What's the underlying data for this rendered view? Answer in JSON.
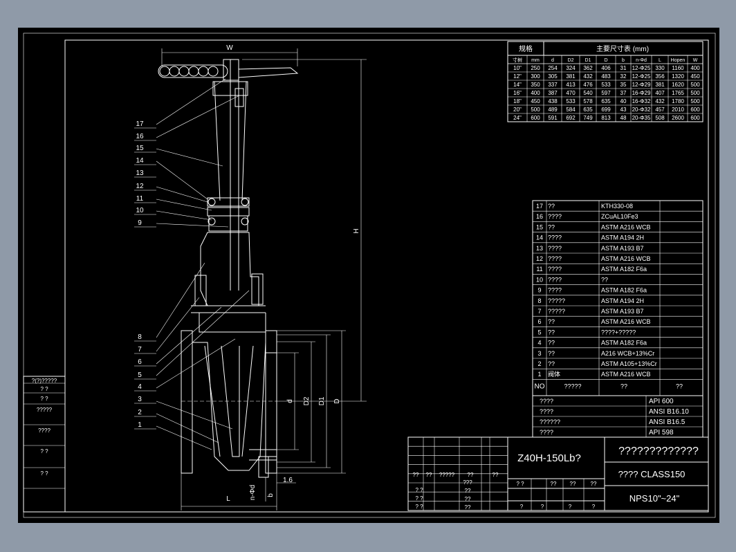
{
  "dimensions": {
    "W": "W",
    "H": "H",
    "L": "L",
    "d": "d",
    "D1": "D1",
    "D2": "D2",
    "D": "D",
    "n_phi_d": "n-Φd",
    "b": "b",
    "t": "1.6"
  },
  "callouts": [
    "17",
    "16",
    "15",
    "14",
    "13",
    "12",
    "11",
    "10",
    "9",
    "8",
    "7",
    "6",
    "5",
    "4",
    "3",
    "2",
    "1"
  ],
  "size_table": {
    "title": "主要尺寸表 (mm)",
    "corner": "规格",
    "headers": [
      "寸树",
      "mm",
      "d",
      "D2",
      "D1",
      "D",
      "b",
      "n-Φd",
      "L",
      "Hopen",
      "W"
    ],
    "rows": [
      [
        "10\"",
        "250",
        "254",
        "324",
        "362",
        "406",
        "31",
        "12-Φ25",
        "330",
        "1160",
        "400"
      ],
      [
        "12\"",
        "300",
        "305",
        "381",
        "432",
        "483",
        "32",
        "12-Φ25",
        "356",
        "1320",
        "450"
      ],
      [
        "14\"",
        "350",
        "337",
        "413",
        "476",
        "533",
        "35",
        "12-Φ29",
        "381",
        "1620",
        "500"
      ],
      [
        "16\"",
        "400",
        "387",
        "470",
        "540",
        "597",
        "37",
        "16-Φ29",
        "407",
        "1765",
        "500"
      ],
      [
        "18\"",
        "450",
        "438",
        "533",
        "578",
        "635",
        "40",
        "16-Φ32",
        "432",
        "1780",
        "500"
      ],
      [
        "20\"",
        "500",
        "489",
        "584",
        "635",
        "699",
        "43",
        "20-Φ32",
        "457",
        "2010",
        "600"
      ],
      [
        "24\"",
        "600",
        "591",
        "692",
        "749",
        "813",
        "48",
        "20-Φ35",
        "508",
        "2600",
        "600"
      ]
    ]
  },
  "parts_list": {
    "rows": [
      [
        "17",
        "??",
        "KTH330-08"
      ],
      [
        "16",
        "????",
        "ZCuAL10Fe3"
      ],
      [
        "15",
        "??",
        "ASTM  A216  WCB"
      ],
      [
        "14",
        "????",
        "ASTM  A194  2H"
      ],
      [
        "13",
        "????",
        "ASTM  A193  B7"
      ],
      [
        "12",
        "????",
        "ASTM  A216  WCB"
      ],
      [
        "11",
        "????",
        "ASTM  A182  F6a"
      ],
      [
        "10",
        "????",
        "??"
      ],
      [
        "9",
        "????",
        "ASTM  A182  F6a"
      ],
      [
        "8",
        "?????",
        "ASTM  A194  2H"
      ],
      [
        "7",
        "?????",
        "ASTM  A193  B7"
      ],
      [
        "6",
        "??",
        "ASTM  A216  WCB"
      ],
      [
        "5",
        "??",
        "????+?????"
      ],
      [
        "4",
        "??",
        "ASTM  A182  F6a"
      ],
      [
        "3",
        "??",
        "A216  WCB+13%Cr"
      ],
      [
        "2",
        "??",
        "ASTM  A105+13%Cr"
      ],
      [
        "1",
        "阀体",
        "ASTM  A216  WCB"
      ]
    ],
    "header": [
      "NO",
      "?????",
      "??",
      "??"
    ]
  },
  "standards": [
    [
      "????",
      "API  600"
    ],
    [
      "????",
      "ANSI  B16.10"
    ],
    [
      "??????",
      "ANSI  B16.5"
    ],
    [
      "????",
      "API  598"
    ]
  ],
  "title_block": {
    "model": "Z40H-150Lb?",
    "name": "?????????????",
    "class": "????  CLASS150",
    "size": "NPS10\"~24\"",
    "left_labels": [
      "??",
      "??",
      "?????",
      "??",
      "??"
    ],
    "mid_labels": [
      "???",
      "??",
      "??",
      "??"
    ],
    "sig_row": [
      "?  ?",
      "??",
      "??",
      "??"
    ],
    "left_rows": [
      "?  ?",
      "?  ?",
      "?  ?"
    ],
    "bottom_row": [
      "?",
      "?",
      "?",
      "?"
    ]
  },
  "left_strip": [
    "?(?)?????",
    "?  ?",
    "?  ?",
    "?????",
    "????",
    "?  ?",
    "?  ?"
  ]
}
